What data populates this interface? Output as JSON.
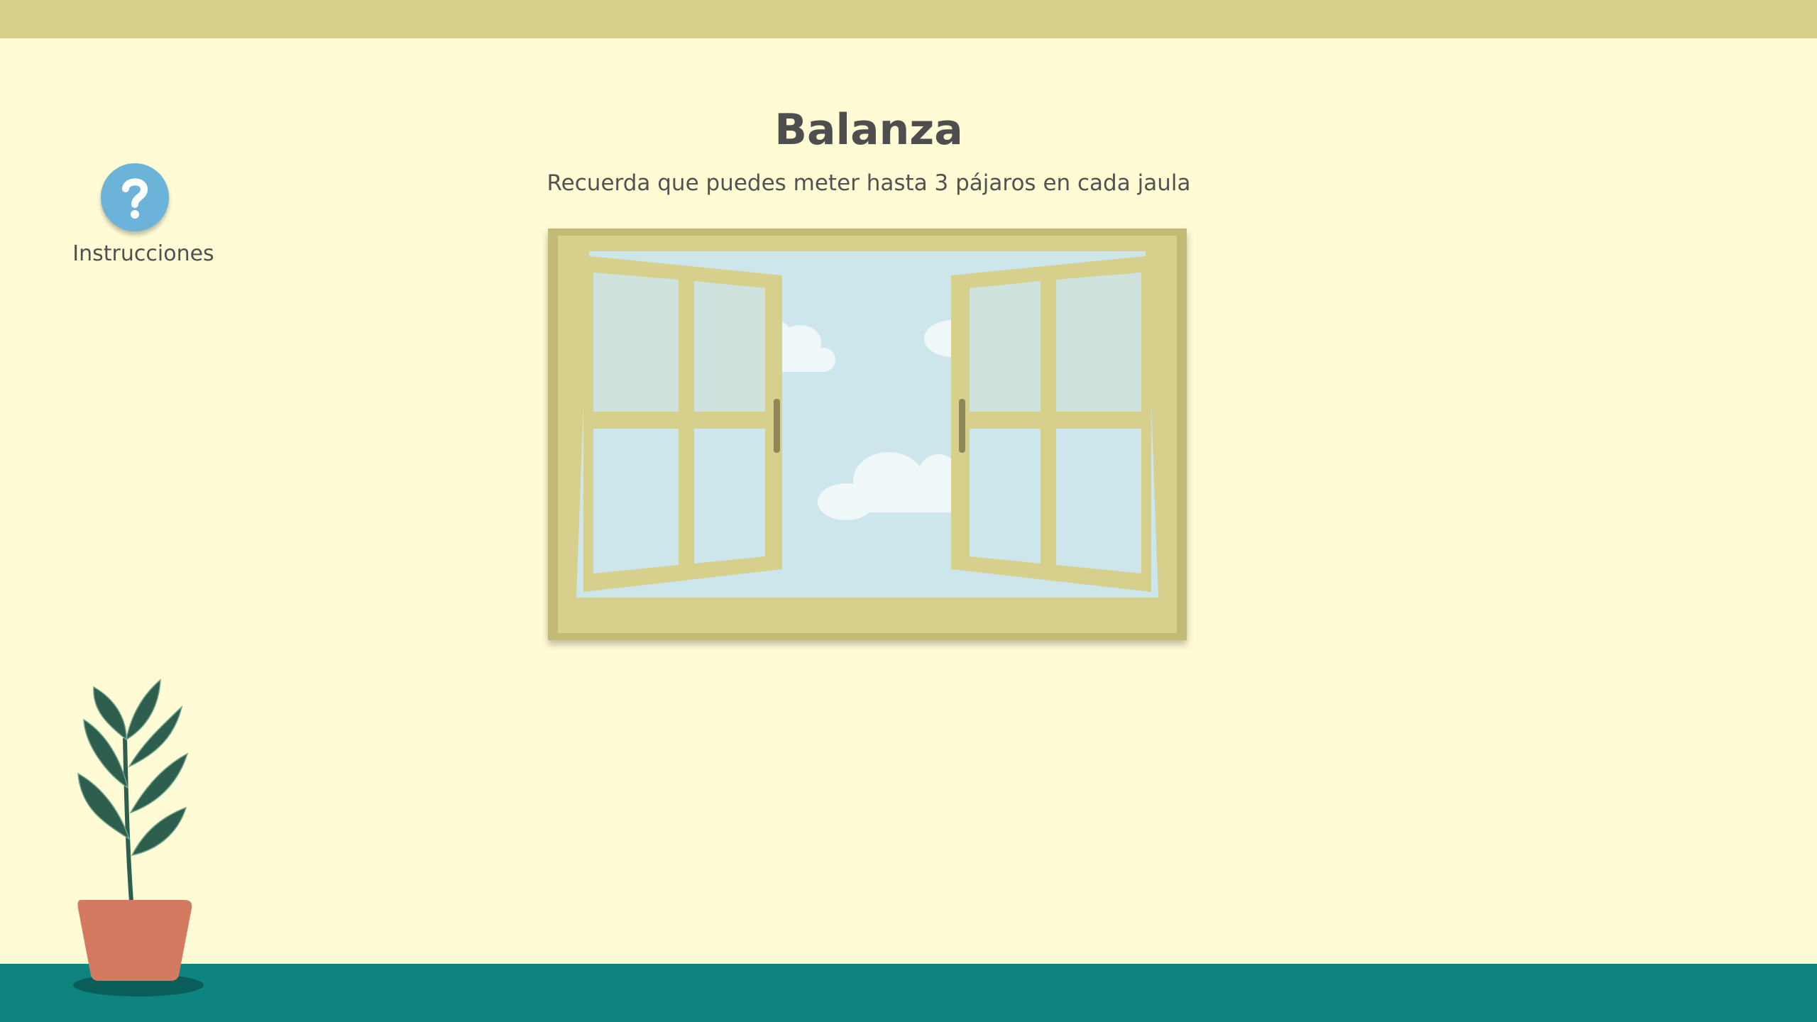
{
  "header": {
    "title": "Balanza",
    "subtitle": "Recuerda que puedes meter hasta 3 pájaros en cada jaula"
  },
  "help": {
    "icon": "question-mark-icon",
    "label": "Instrucciones"
  },
  "scene": {
    "window": "open-window-illustration",
    "plant": "potted-plant-illustration"
  },
  "colors": {
    "background": "#fffbd5",
    "top_bar": "#d6d08c",
    "floor": "#0e8480",
    "window_frame": "#d6d08c",
    "sky": "#cde6ec",
    "help_button": "#6cb3d9",
    "pot": "#d47a60",
    "leaves": "#2e5e4e"
  }
}
